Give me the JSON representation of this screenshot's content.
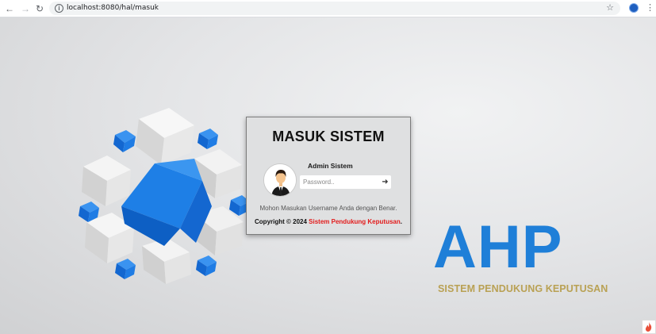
{
  "browser": {
    "url": "localhost:8080/hal/masuk"
  },
  "login": {
    "title": "MASUK SISTEM",
    "user_label": "Admin Sistem",
    "password_placeholder": "Password..",
    "hint": "Mohon Masukan Username Anda dengan Benar.",
    "copyright_prefix": "Copyright © 2024",
    "copyright_brand": "Sistem Pendukung Keputusan",
    "copyright_suffix": "."
  },
  "branding": {
    "logo_text": "AHP",
    "tagline": "SISTEM PENDUKUNG KEPUTUSAN"
  },
  "colors": {
    "accent_blue": "#1f7fd8",
    "brand_red": "#e31b1b",
    "tagline_gold": "#b9a154"
  }
}
